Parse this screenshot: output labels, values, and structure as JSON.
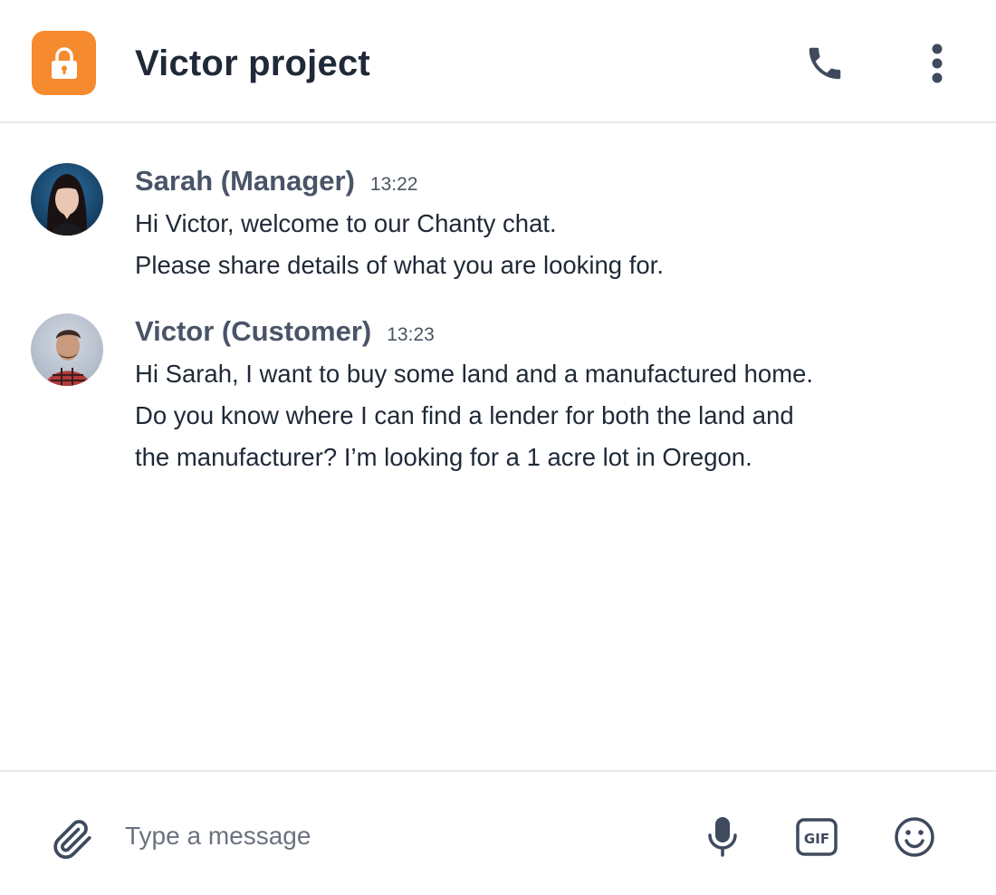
{
  "header": {
    "title": "Victor project"
  },
  "messages": [
    {
      "author": "Sarah (Manager)",
      "time": "13:22",
      "lines": [
        "Hi Victor, welcome to our Chanty chat.",
        "Please share details of what you are looking for."
      ]
    },
    {
      "author": "Victor (Customer)",
      "time": "13:23",
      "lines": [
        "Hi Sarah, I want to buy some land and a manufactured home.",
        "Do you know where I can find a lender for both the land and",
        "the manufacturer? I’m looking for a 1 acre lot in Oregon."
      ]
    }
  ],
  "composer": {
    "placeholder": "Type a message",
    "gif_label": "GIF"
  },
  "icons": {
    "lock": "lock-icon",
    "phone": "phone-icon",
    "more": "more-vertical-icon",
    "attach": "paperclip-icon",
    "mic": "microphone-icon",
    "gif": "gif-icon",
    "emoji": "smiley-icon"
  },
  "colors": {
    "accent": "#f68a2e",
    "icon": "#3f4a5e",
    "author": "#4a5468",
    "divider": "#e5e7eb"
  }
}
